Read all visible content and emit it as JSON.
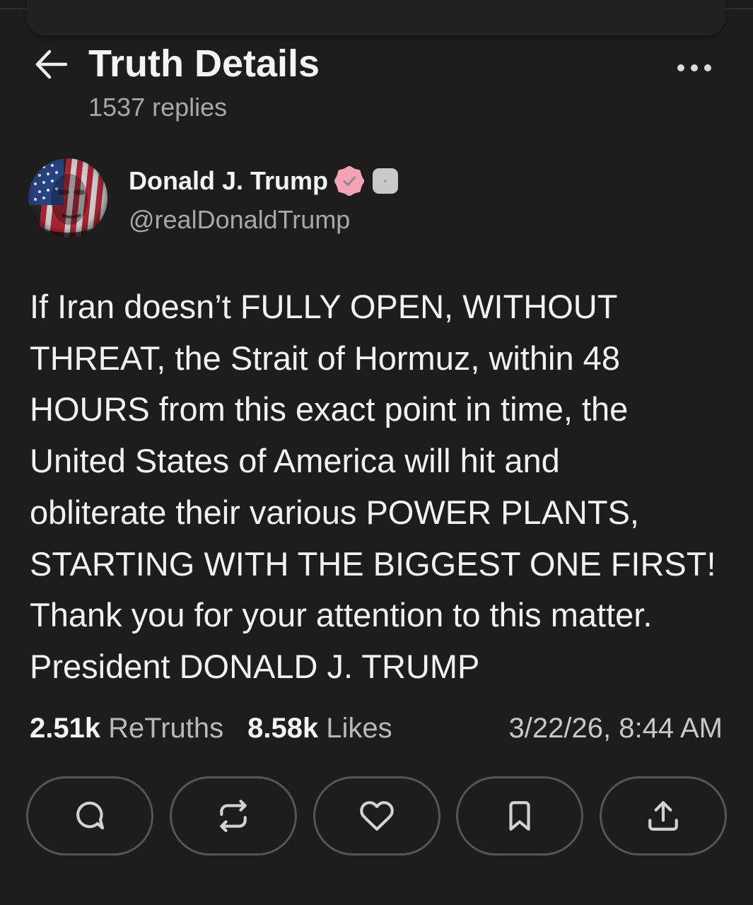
{
  "colors": {
    "background": "#1d1d1d",
    "text": "#f2f2f2",
    "muted": "#a8a8a8",
    "verified_badge": "#f4a3b7",
    "button_border": "#555555"
  },
  "header": {
    "back_icon": "back-arrow-icon",
    "title": "Truth Details",
    "replies": "1537 replies",
    "more_icon": "more-horizontal-icon"
  },
  "author": {
    "name": "Donald J. Trump",
    "badges": [
      "verified-badge-icon",
      "account-badge-icon"
    ],
    "handle": "@realDonaldTrump"
  },
  "post": {
    "lines": [
      "If Iran doesn’t FULLY OPEN, WITHOUT",
      "THREAT, the Strait of Hormuz, within 48",
      "HOURS from this exact point in time, the",
      "United States of America will hit and",
      "obliterate their various POWER PLANTS,",
      "STARTING WITH THE BIGGEST ONE FIRST!",
      "Thank you for your attention to this matter.",
      "President DONALD J. TRUMP"
    ]
  },
  "stats": {
    "retruths_count": "2.51k",
    "retruths_label": "ReTruths",
    "likes_count": "8.58k",
    "likes_label": "Likes",
    "timestamp": "3/22/26, 8:44 AM"
  },
  "actions": [
    {
      "icon": "comment-icon"
    },
    {
      "icon": "retruth-icon"
    },
    {
      "icon": "heart-icon"
    },
    {
      "icon": "bookmark-icon"
    },
    {
      "icon": "share-icon"
    }
  ]
}
